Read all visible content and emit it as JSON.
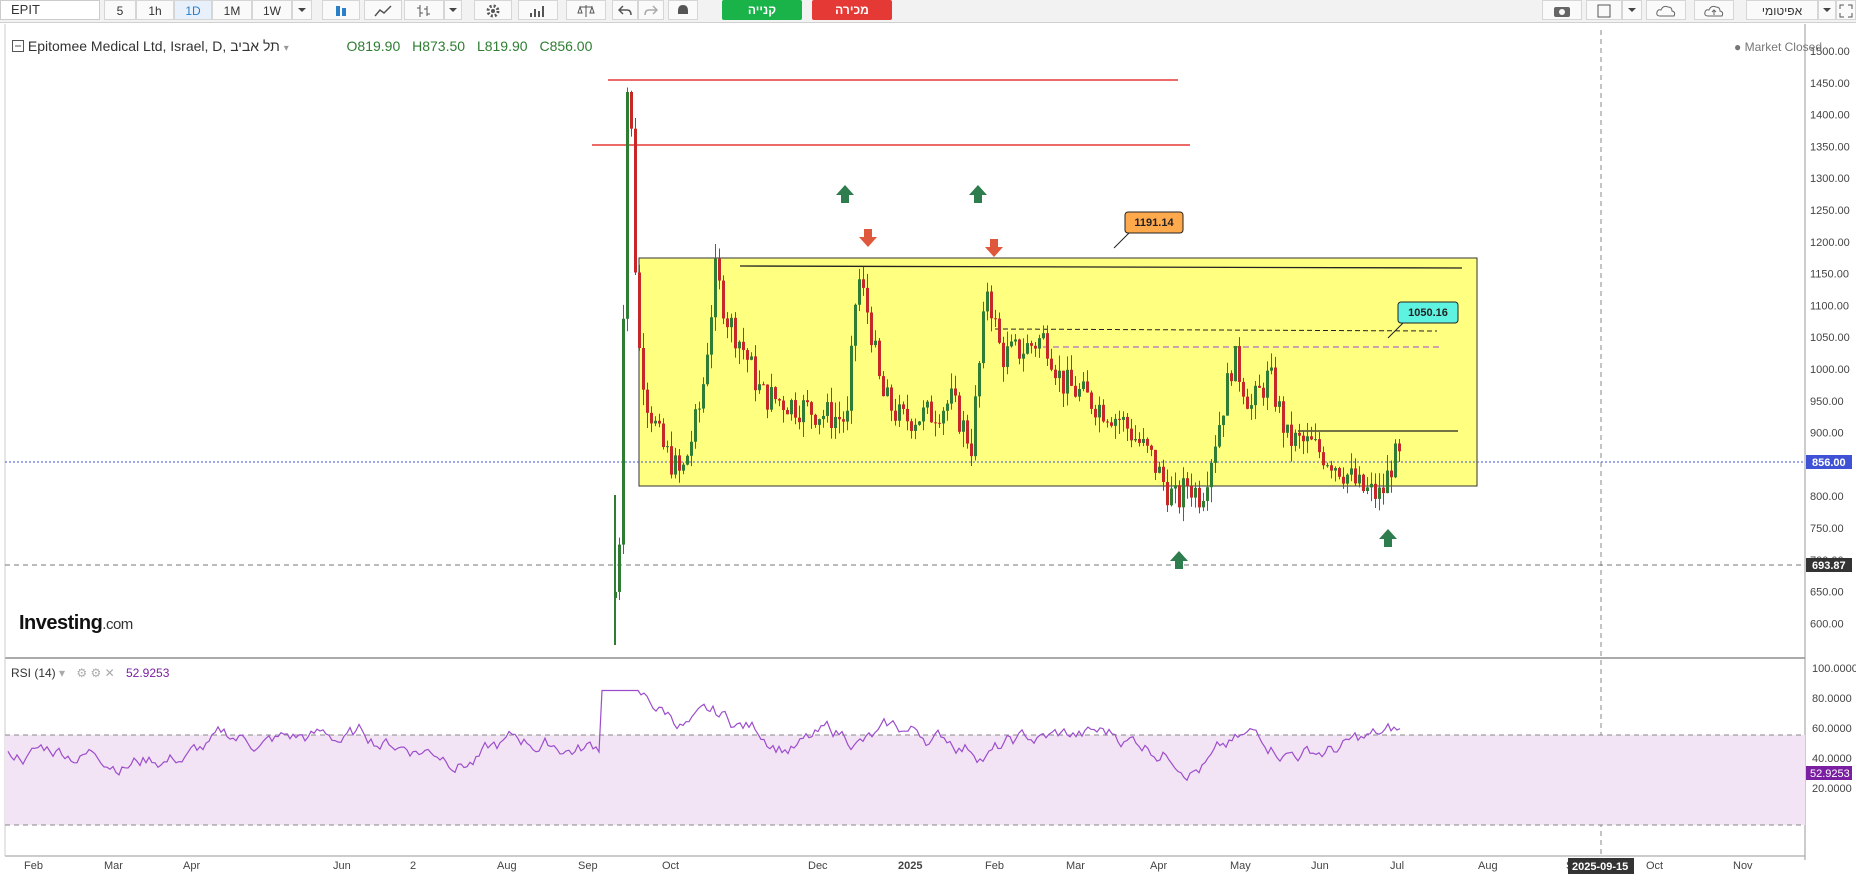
{
  "toolbar": {
    "symbol": "EPIT",
    "intervals": [
      "5",
      "1h",
      "1D",
      "1M",
      "1W"
    ],
    "active_interval": "1D",
    "buy_label": "קנייה",
    "sell_label": "מכירה",
    "right_label": "אפיטומי"
  },
  "legend": {
    "title": "Epitomee Medical Ltd, Israel, D, תל אביב",
    "open": "O819.90",
    "high": "H873.50",
    "low": "L819.90",
    "close": "C856.00",
    "market_status": "Market Closed"
  },
  "logo": {
    "brand": "Investing",
    "suffix": ".com"
  },
  "rsi": {
    "label": "RSI (14)",
    "value": "52.9253"
  },
  "annotations": {
    "callout_top": "1191.14",
    "callout_mid": "1050.16"
  },
  "price_axis": {
    "ticks": [
      "1500.00",
      "1450.00",
      "1400.00",
      "1350.00",
      "1300.00",
      "1250.00",
      "1200.00",
      "1150.00",
      "1100.00",
      "1050.00",
      "1000.00",
      "950.00",
      "900.00",
      "850.00",
      "800.00",
      "750.00",
      "700.00",
      "650.00",
      "600.00"
    ],
    "last_price": "856.00",
    "support_price": "693.87"
  },
  "rsi_axis": {
    "ticks": [
      "100.0000",
      "80.0000",
      "60.0000",
      "40.0000",
      "20.0000"
    ],
    "last_value": "52.9253"
  },
  "time_axis": {
    "labels": [
      "Feb",
      "Mar",
      "Apr",
      "Jun",
      "2",
      "Aug",
      "Sep",
      "Oct",
      "Dec",
      "2025",
      "Feb",
      "Mar",
      "Apr",
      "May",
      "Jun",
      "Jul",
      "Aug",
      "Sep",
      "Oct",
      "Nov"
    ],
    "crosshair_date": "2025-09-15"
  },
  "colors": {
    "up": "#2e7d32",
    "down": "#c62828",
    "rect_fill": "#ffff80",
    "rsi_line": "#9c4dcc",
    "rsi_band": "#f3e4f5",
    "last_price": "#3f51d5"
  },
  "icons": [
    "candles-icon",
    "line-chart-icon",
    "bars-icon",
    "settings-icon",
    "indicators-icon",
    "compare-icon",
    "undo-icon",
    "redo-icon",
    "alert-icon",
    "camera-icon",
    "layout-icon",
    "cloud-load-icon",
    "cloud-save-icon",
    "fullscreen-icon"
  ]
}
